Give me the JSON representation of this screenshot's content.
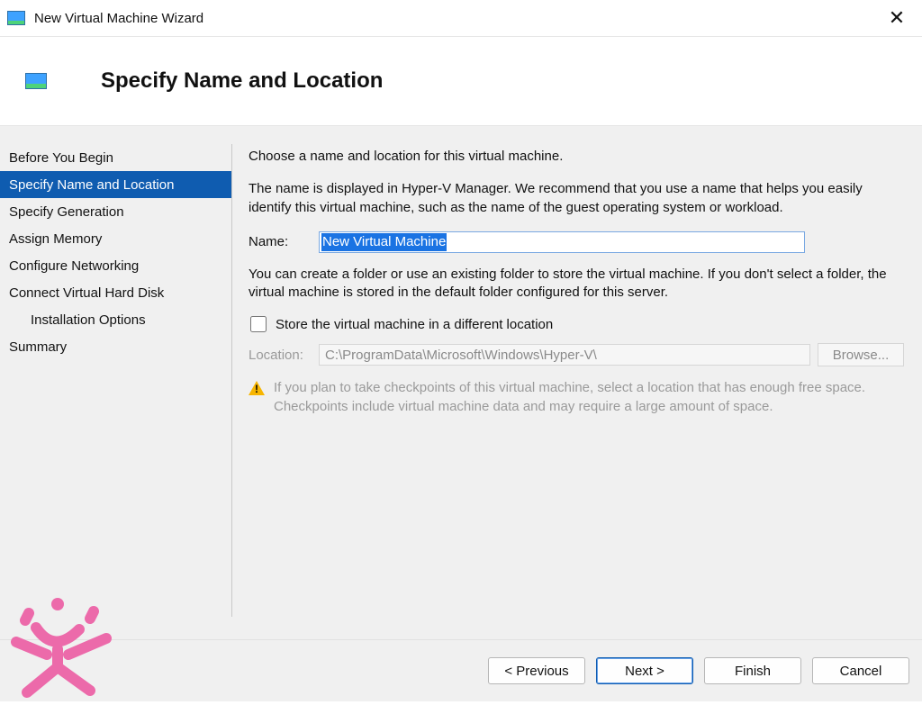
{
  "window": {
    "title": "New Virtual Machine Wizard"
  },
  "header": {
    "heading": "Specify Name and Location"
  },
  "sidebar": {
    "items": [
      {
        "label": "Before You Begin",
        "selected": false,
        "sub": false
      },
      {
        "label": "Specify Name and Location",
        "selected": true,
        "sub": false
      },
      {
        "label": "Specify Generation",
        "selected": false,
        "sub": false
      },
      {
        "label": "Assign Memory",
        "selected": false,
        "sub": false
      },
      {
        "label": "Configure Networking",
        "selected": false,
        "sub": false
      },
      {
        "label": "Connect Virtual Hard Disk",
        "selected": false,
        "sub": false
      },
      {
        "label": "Installation Options",
        "selected": false,
        "sub": true
      },
      {
        "label": "Summary",
        "selected": false,
        "sub": false
      }
    ]
  },
  "main": {
    "intro": "Choose a name and location for this virtual machine.",
    "name_help": "The name is displayed in Hyper-V Manager. We recommend that you use a name that helps you easily identify this virtual machine, such as the name of the guest operating system or workload.",
    "name_label": "Name:",
    "name_value": "New Virtual Machine",
    "location_help": "You can create a folder or use an existing folder to store the virtual machine. If you don't select a folder, the virtual machine is stored in the default folder configured for this server.",
    "store_checkbox_label": "Store the virtual machine in a different location",
    "store_checked": false,
    "location_label": "Location:",
    "location_value": "C:\\ProgramData\\Microsoft\\Windows\\Hyper-V\\",
    "browse_label": "Browse...",
    "warning_text": "If you plan to take checkpoints of this virtual machine, select a location that has enough free space. Checkpoints include virtual machine data and may require a large amount of space."
  },
  "footer": {
    "previous": "< Previous",
    "next": "Next >",
    "finish": "Finish",
    "cancel": "Cancel"
  }
}
